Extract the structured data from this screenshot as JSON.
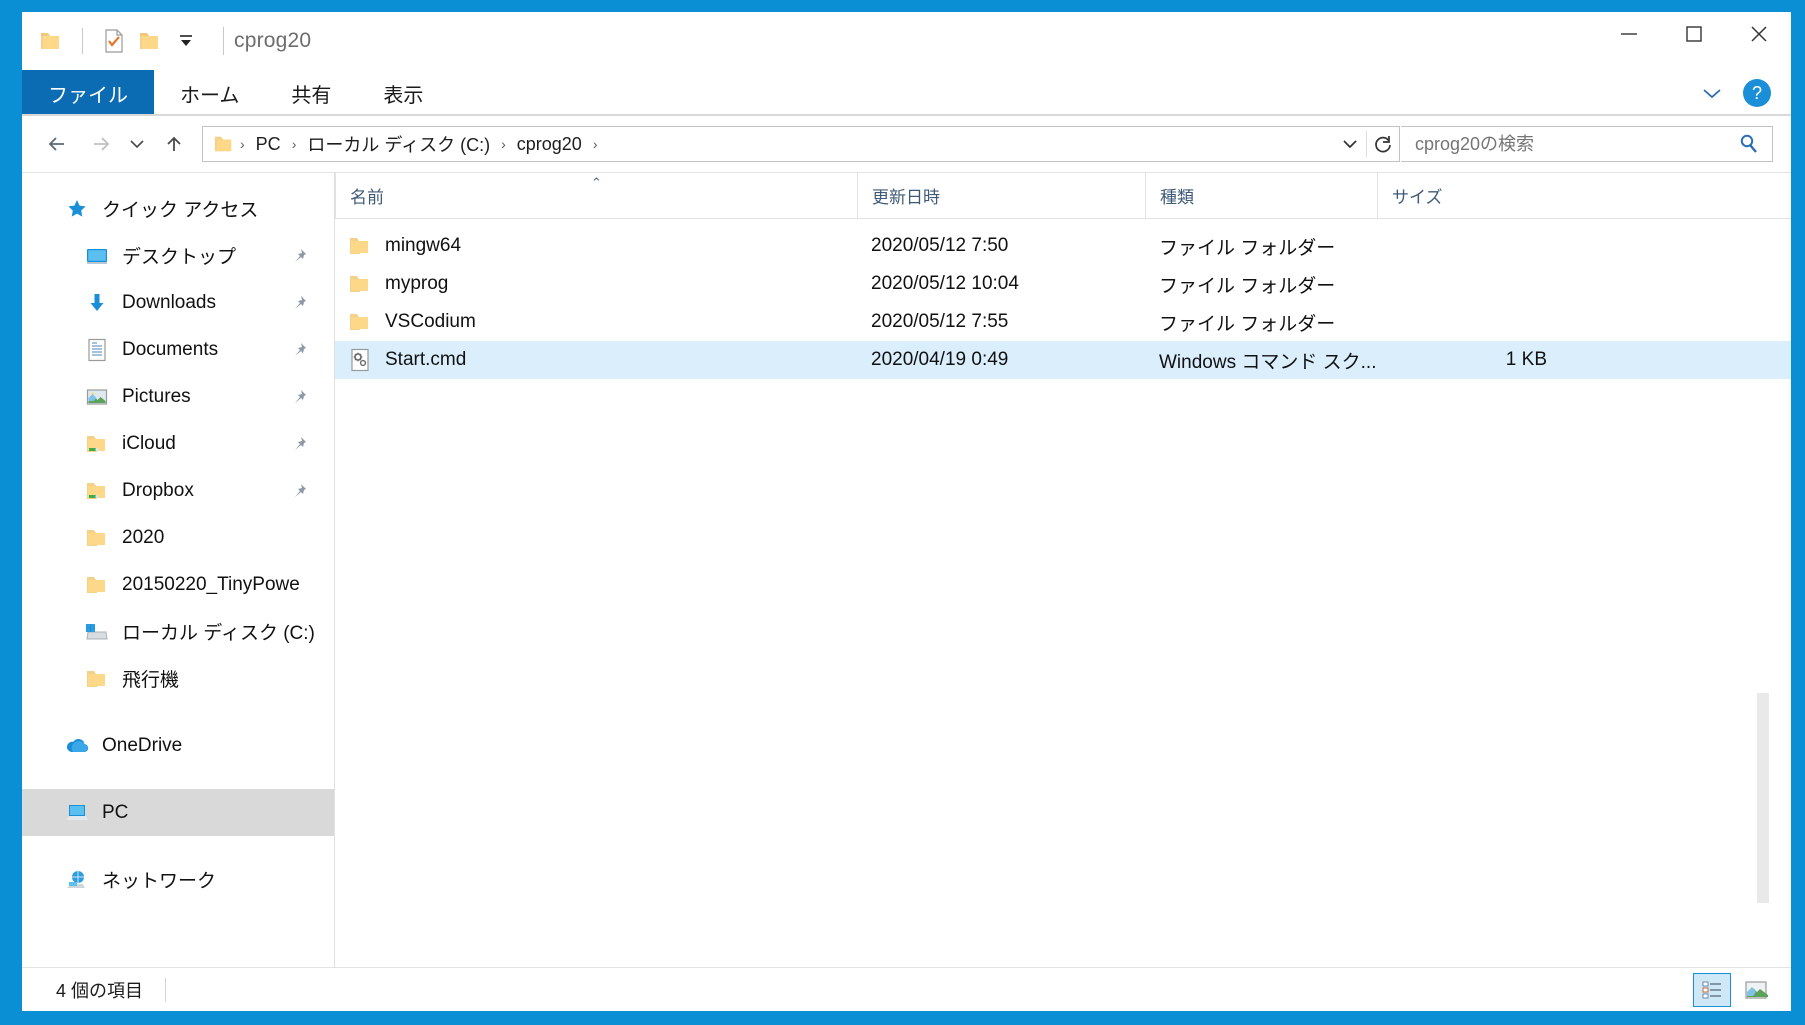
{
  "window": {
    "title": "cprog20",
    "quick_access": [
      "folder-icon",
      "checkbox-doc-icon",
      "new-folder-icon",
      "customize-dropdown-icon"
    ],
    "controls": {
      "minimize": "minimize-button",
      "maximize": "maximize-button",
      "close": "close-button"
    }
  },
  "ribbon": {
    "tabs": [
      {
        "label": "ファイル",
        "active": true
      },
      {
        "label": "ホーム",
        "active": false
      },
      {
        "label": "共有",
        "active": false
      },
      {
        "label": "表示",
        "active": false
      }
    ],
    "expand_label": "リボンの展開",
    "help_label": "?"
  },
  "navigation": {
    "back": "←",
    "forward": "→",
    "recent": "⌄",
    "up": "↑",
    "breadcrumbs": [
      "PC",
      "ローカル ディスク (C:)",
      "cprog20"
    ],
    "separator": "›",
    "dropdown": "⌄",
    "refresh": "↻"
  },
  "search": {
    "placeholder": "cprog20の検索",
    "value": "",
    "icon": "search-icon"
  },
  "sidebar": {
    "items": [
      {
        "label": "クイック アクセス",
        "icon": "star-pin-icon",
        "level": 0,
        "pinned": false,
        "selected": false
      },
      {
        "label": "デスクトップ",
        "icon": "desktop-icon",
        "level": 1,
        "pinned": true,
        "selected": false
      },
      {
        "label": "Downloads",
        "icon": "download-icon",
        "level": 1,
        "pinned": true,
        "selected": false
      },
      {
        "label": "Documents",
        "icon": "documents-icon",
        "level": 1,
        "pinned": true,
        "selected": false
      },
      {
        "label": "Pictures",
        "icon": "pictures-icon",
        "level": 1,
        "pinned": true,
        "selected": false
      },
      {
        "label": "iCloud",
        "icon": "shortcut-folder-icon",
        "level": 1,
        "pinned": true,
        "selected": false
      },
      {
        "label": "Dropbox",
        "icon": "shortcut-folder-icon",
        "level": 1,
        "pinned": true,
        "selected": false
      },
      {
        "label": "2020",
        "icon": "folder-icon",
        "level": 1,
        "pinned": false,
        "selected": false
      },
      {
        "label": "20150220_TinyPowe",
        "icon": "folder-icon",
        "level": 1,
        "pinned": false,
        "selected": false
      },
      {
        "label": "ローカル ディスク (C:)",
        "icon": "drive-icon",
        "level": 1,
        "pinned": false,
        "selected": false
      },
      {
        "label": "飛行機",
        "icon": "folder-icon",
        "level": 1,
        "pinned": false,
        "selected": false
      },
      {
        "label": "OneDrive",
        "icon": "onedrive-icon",
        "level": 0,
        "pinned": false,
        "selected": false,
        "gap_before": true
      },
      {
        "label": "PC",
        "icon": "pc-icon",
        "level": 0,
        "pinned": false,
        "selected": true,
        "gap_before": true
      },
      {
        "label": "ネットワーク",
        "icon": "network-icon",
        "level": 0,
        "pinned": false,
        "selected": false,
        "gap_before": true
      }
    ]
  },
  "filelist": {
    "columns": [
      {
        "label": "名前",
        "sorted": true,
        "sort_direction": "ascending",
        "sort_glyph": "⌃"
      },
      {
        "label": "更新日時",
        "sorted": false
      },
      {
        "label": "種類",
        "sorted": false
      },
      {
        "label": "サイズ",
        "sorted": false
      }
    ],
    "rows": [
      {
        "name": "mingw64",
        "date": "2020/05/12 7:50",
        "type": "ファイル フォルダー",
        "size": "",
        "icon": "folder-icon",
        "selected": false
      },
      {
        "name": "myprog",
        "date": "2020/05/12 10:04",
        "type": "ファイル フォルダー",
        "size": "",
        "icon": "folder-icon",
        "selected": false
      },
      {
        "name": "VSCodium",
        "date": "2020/05/12 7:55",
        "type": "ファイル フォルダー",
        "size": "",
        "icon": "folder-icon",
        "selected": false
      },
      {
        "name": "Start.cmd",
        "date": "2020/04/19 0:49",
        "type": "Windows コマンド スク...",
        "size": "1 KB",
        "icon": "cmd-script-icon",
        "selected": true
      }
    ]
  },
  "statusbar": {
    "item_count": "4 個の項目",
    "views": [
      {
        "name": "details-view-button",
        "active": true
      },
      {
        "name": "large-icons-view-button",
        "active": false
      }
    ]
  },
  "colors": {
    "accent": "#0b6cb3",
    "window_border": "#0b8fd4",
    "selection": "#daeefc",
    "nav_selection": "#d9d9d9",
    "header_text": "#3f5a77"
  }
}
